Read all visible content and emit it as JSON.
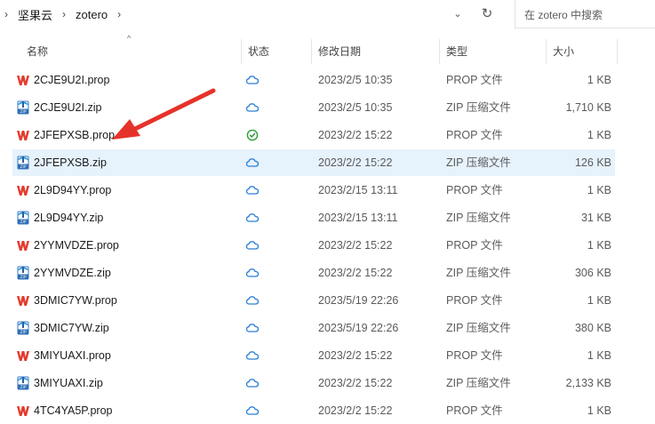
{
  "address": {
    "crumbs": [
      "坚果云",
      "zotero"
    ],
    "search_placeholder": "在 zotero 中搜索"
  },
  "columns": {
    "name": "名称",
    "status": "状态",
    "modified": "修改日期",
    "type": "类型",
    "size": "大小"
  },
  "colors": {
    "selected_row": "#e6f2fc",
    "cloud_icon": "#2a7fd4",
    "synced_icon": "#2e9e3a",
    "wps_red": "#e33b2e",
    "arrow_red": "#e5332a"
  },
  "files": [
    {
      "name": "2CJE9U2I.prop",
      "icon": "wps-file-icon",
      "status": "cloud-icon",
      "modified": "2023/2/5 10:35",
      "type": "PROP 文件",
      "size": "1 KB"
    },
    {
      "name": "2CJE9U2I.zip",
      "icon": "zip-file-icon",
      "status": "cloud-icon",
      "modified": "2023/2/5 10:35",
      "type": "ZIP 压缩文件",
      "size": "1,710 KB"
    },
    {
      "name": "2JFEPXSB.prop",
      "icon": "wps-file-icon",
      "status": "synced-check-icon",
      "modified": "2023/2/2 15:22",
      "type": "PROP 文件",
      "size": "1 KB"
    },
    {
      "name": "2JFEPXSB.zip",
      "icon": "zip-file-icon",
      "status": "cloud-icon",
      "modified": "2023/2/2 15:22",
      "type": "ZIP 压缩文件",
      "size": "126 KB",
      "selected": true
    },
    {
      "name": "2L9D94YY.prop",
      "icon": "wps-file-icon",
      "status": "cloud-icon",
      "modified": "2023/2/15 13:11",
      "type": "PROP 文件",
      "size": "1 KB"
    },
    {
      "name": "2L9D94YY.zip",
      "icon": "zip-file-icon",
      "status": "cloud-icon",
      "modified": "2023/2/15 13:11",
      "type": "ZIP 压缩文件",
      "size": "31 KB"
    },
    {
      "name": "2YYMVDZE.prop",
      "icon": "wps-file-icon",
      "status": "cloud-icon",
      "modified": "2023/2/2 15:22",
      "type": "PROP 文件",
      "size": "1 KB"
    },
    {
      "name": "2YYMVDZE.zip",
      "icon": "zip-file-icon",
      "status": "cloud-icon",
      "modified": "2023/2/2 15:22",
      "type": "ZIP 压缩文件",
      "size": "306 KB"
    },
    {
      "name": "3DMIC7YW.prop",
      "icon": "wps-file-icon",
      "status": "cloud-icon",
      "modified": "2023/5/19 22:26",
      "type": "PROP 文件",
      "size": "1 KB"
    },
    {
      "name": "3DMIC7YW.zip",
      "icon": "zip-file-icon",
      "status": "cloud-icon",
      "modified": "2023/5/19 22:26",
      "type": "ZIP 压缩文件",
      "size": "380 KB"
    },
    {
      "name": "3MIYUAXI.prop",
      "icon": "wps-file-icon",
      "status": "cloud-icon",
      "modified": "2023/2/2 15:22",
      "type": "PROP 文件",
      "size": "1 KB"
    },
    {
      "name": "3MIYUAXI.zip",
      "icon": "zip-file-icon",
      "status": "cloud-icon",
      "modified": "2023/2/2 15:22",
      "type": "ZIP 压缩文件",
      "size": "2,133 KB"
    },
    {
      "name": "4TC4YA5P.prop",
      "icon": "wps-file-icon",
      "status": "cloud-icon",
      "modified": "2023/2/2 15:22",
      "type": "PROP 文件",
      "size": "1 KB"
    }
  ]
}
